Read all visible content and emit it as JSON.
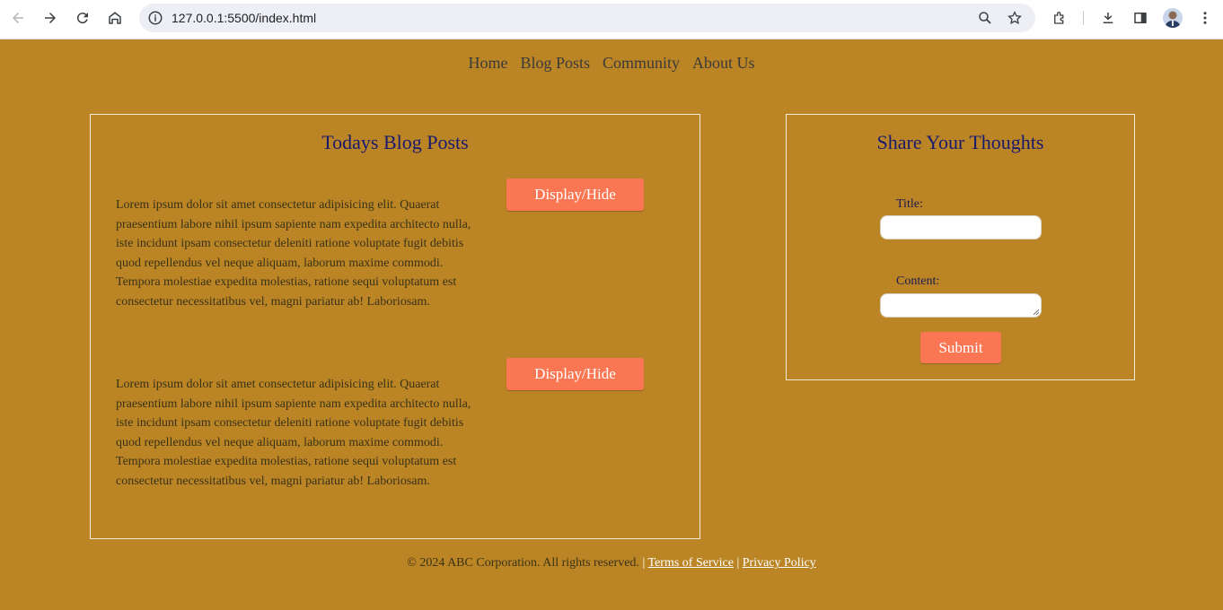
{
  "browser": {
    "url": "127.0.0.1:5500/index.html"
  },
  "nav": {
    "items": [
      "Home",
      "Blog Posts",
      "Community",
      "About Us"
    ]
  },
  "blog": {
    "heading": "Todays Blog Posts",
    "posts": [
      {
        "text": "Lorem ipsum dolor sit amet consectetur adipisicing elit. Quaerat praesentium labore nihil ipsum sapiente nam expedita architecto nulla, iste incidunt ipsam consectetur deleniti ratione voluptate fugit debitis quod repellendus vel neque aliquam, laborum maxime commodi. Tempora molestiae expedita molestias, ratione sequi voluptatum est consectetur necessitatibus vel, magni pariatur ab! Laboriosam.",
        "button_label": "Display/Hide"
      },
      {
        "text": "Lorem ipsum dolor sit amet consectetur adipisicing elit. Quaerat praesentium labore nihil ipsum sapiente nam expedita architecto nulla, iste incidunt ipsam consectetur deleniti ratione voluptate fugit debitis quod repellendus vel neque aliquam, laborum maxime commodi. Tempora molestiae expedita molestias, ratione sequi voluptatum est consectetur necessitatibus vel, magni pariatur ab! Laboriosam.",
        "button_label": "Display/Hide"
      }
    ]
  },
  "thoughts": {
    "heading": "Share Your Thoughts",
    "title_label": "Title:",
    "title_value": "",
    "content_label": "Content:",
    "content_value": "",
    "submit_label": "Submit"
  },
  "footer": {
    "copyright": "© 2024 ABC Corporation. All rights reserved.",
    "separator": "|",
    "terms": "Terms of Service",
    "privacy": "Privacy Policy"
  },
  "colors": {
    "page_background": "#bb8526",
    "button": "#fb7754",
    "heading": "#1a1a6c"
  }
}
